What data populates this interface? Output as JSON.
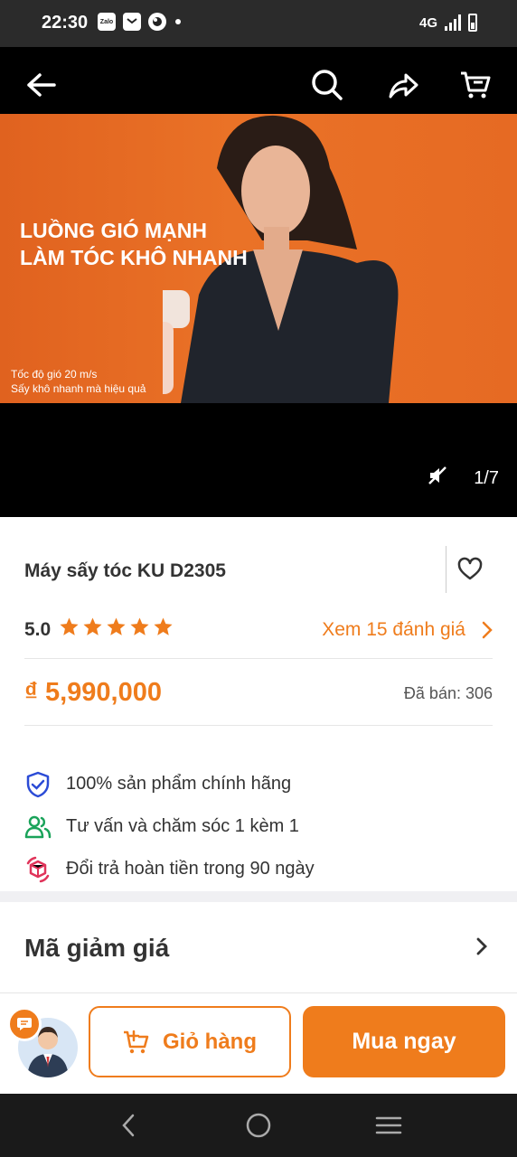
{
  "status_bar": {
    "time": "22:30",
    "zalo_label": "Zalo",
    "network": "4G"
  },
  "nav": {
    "back_icon": "arrow-left-icon",
    "search_icon": "search-icon",
    "share_icon": "share-icon",
    "cart_icon": "cart-icon"
  },
  "hero": {
    "headline_line1": "LUỒNG GIÓ MẠNH",
    "headline_line2": "LÀM TÓC KHÔ NHANH",
    "sub_line1": "Tốc độ gió 20 m/s",
    "sub_line2": "Sấy khô nhanh mà hiệu quả",
    "mute_icon": "mute-icon",
    "counter": "1/7",
    "background_color": "#e86c24"
  },
  "product": {
    "title": "Máy sấy tóc KU D2305",
    "favorite_icon": "heart-icon",
    "rating": "5.0",
    "stars": 5,
    "reviews_link": "Xem 15 đánh giá",
    "price": "₫ 5,990,000",
    "sold": "Đã bán: 306"
  },
  "features": [
    {
      "icon": "shield-check-icon",
      "text": "100% sản phẩm chính hãng",
      "color": "#2b4bd6"
    },
    {
      "icon": "users-icon",
      "text": "Tư vấn và chăm sóc 1 kèm 1",
      "color": "#1aa35a"
    },
    {
      "icon": "return-box-icon",
      "text": "Đổi trả hoàn tiền trong 90 ngày",
      "color": "#e0345a"
    }
  ],
  "coupon": {
    "title": "Mã giảm giá"
  },
  "bottom_bar": {
    "chat_icon": "chat-icon",
    "cart_label": "Giỏ hàng",
    "buy_label": "Mua ngay"
  },
  "colors": {
    "accent": "#ef7c1c"
  }
}
